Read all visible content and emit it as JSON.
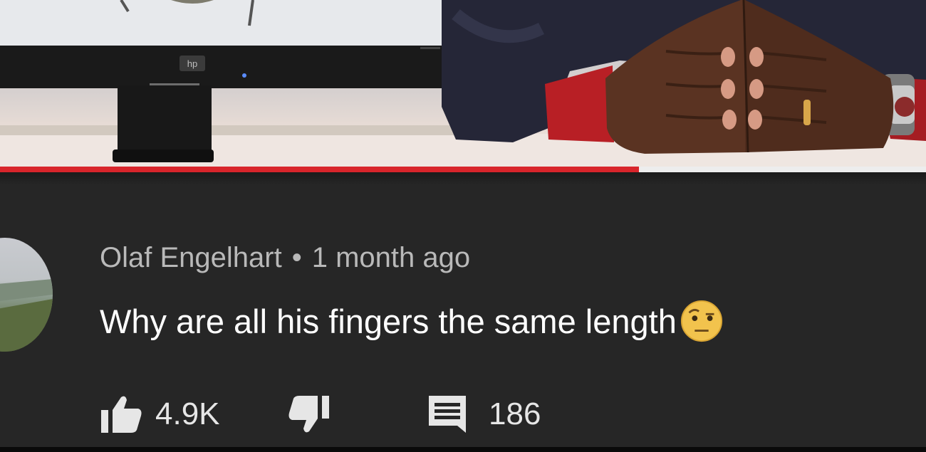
{
  "video": {
    "monitor_brand": "hp",
    "progress_fraction": 0.69
  },
  "comment": {
    "author": "Olaf Engelhart",
    "separator": "•",
    "timestamp": "1 month ago",
    "text": "Why are all his fingers the same length",
    "emoji_icon": "face-with-raised-eyebrow-icon",
    "likes": "4.9K",
    "replies": "186"
  },
  "colors": {
    "background": "#262626",
    "progress": "#d8252b",
    "meta_text": "#b9b9b9",
    "comment_text": "#ffffff"
  }
}
